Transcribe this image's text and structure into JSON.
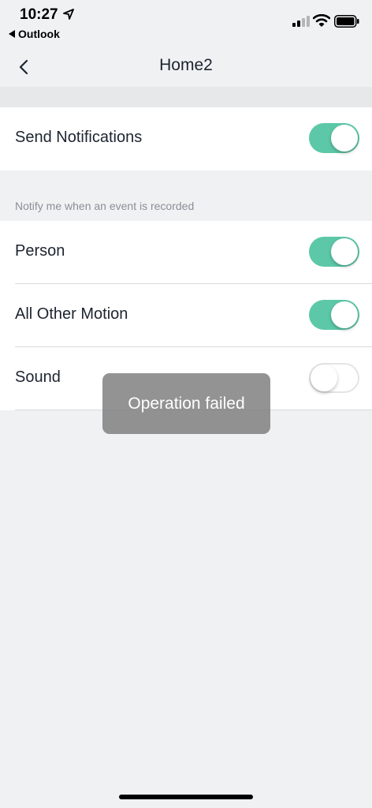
{
  "status_bar": {
    "time": "10:27",
    "back_app": "Outlook",
    "icons": [
      "location-arrow-icon",
      "cellular-signal-icon",
      "wifi-icon",
      "battery-icon"
    ]
  },
  "nav": {
    "title": "Home2",
    "back_icon": "chevron-left-icon"
  },
  "notifications": {
    "label": "Send Notifications",
    "enabled": true
  },
  "events_section": {
    "caption": "Notify me when an event is recorded",
    "items": [
      {
        "label": "Person",
        "enabled": true
      },
      {
        "label": "All Other Motion",
        "enabled": true
      },
      {
        "label": "Sound",
        "enabled": false
      }
    ]
  },
  "toast": {
    "message": "Operation failed"
  },
  "colors": {
    "accent": "#5cc8a8",
    "background": "#f0f1f3",
    "card": "#ffffff",
    "text": "#1c2430",
    "caption": "#8a8f96"
  }
}
